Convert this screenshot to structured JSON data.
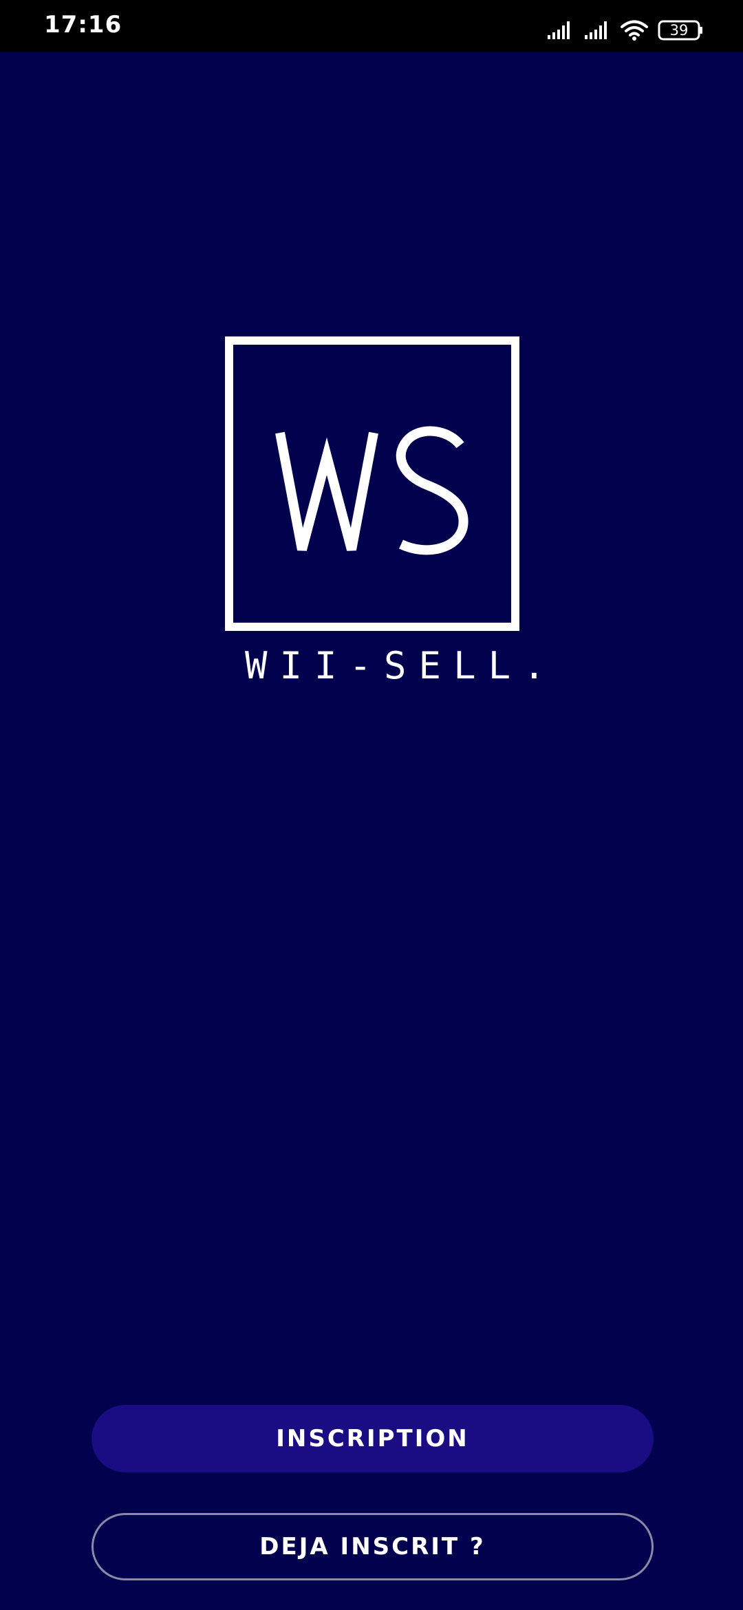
{
  "status_bar": {
    "time": "17:16",
    "battery_level": "39",
    "icons": [
      "signal-icon",
      "signal-icon",
      "wifi-icon",
      "battery-icon"
    ]
  },
  "brand": {
    "monogram": "WS",
    "wordmark": "WII-SELL."
  },
  "actions": {
    "signup_label": "INSCRIPTION",
    "login_label": "DEJA INSCRIT ?"
  },
  "colors": {
    "background": "#01014e",
    "status_bar": "#000000",
    "primary_button": "#1a0c82",
    "secondary_button_border": "#8a8aa8",
    "text": "#ffffff"
  }
}
